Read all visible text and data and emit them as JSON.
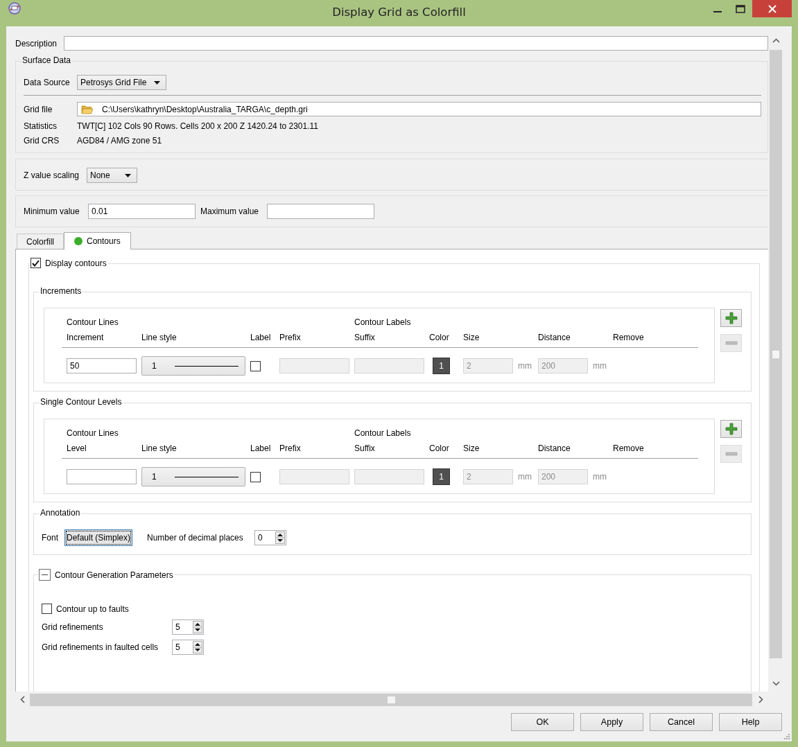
{
  "window": {
    "title": "Display Grid as Colorfill"
  },
  "description": {
    "label": "Description"
  },
  "surface_data": {
    "title": "Surface Data",
    "data_source": {
      "label": "Data Source",
      "value": "Petrosys Grid File"
    },
    "grid_file": {
      "label": "Grid file",
      "value": "C:\\Users\\kathryn\\Desktop\\Australia_TARGA\\c_depth.gri"
    },
    "statistics": {
      "label": "Statistics",
      "value": "TWT[C] 102 Cols 90 Rows. Cells 200 x 200 Z 1420.24 to 2301.11"
    },
    "grid_crs": {
      "label": "Grid CRS",
      "value": "AGD84 / AMG zone 51"
    }
  },
  "z_value_scaling": {
    "label": "Z value scaling",
    "value": "None"
  },
  "minimum_value": {
    "label": "Minimum value",
    "value": "0.01"
  },
  "maximum_value": {
    "label": "Maximum value"
  },
  "tabs": [
    {
      "label": "Colorfill",
      "selected": false
    },
    {
      "label": "Contours",
      "selected": true,
      "color": "#3dae2b"
    }
  ],
  "display_contours": {
    "label": "Display contours",
    "checked": true
  },
  "increments": {
    "title": "Increments",
    "lines_header": "Contour Lines",
    "labels_header": "Contour Labels",
    "columns": [
      "Increment",
      "Line style",
      "Label",
      "Prefix",
      "Suffix",
      "Color",
      "Size",
      "Distance",
      "Remove"
    ],
    "rows": [
      {
        "value": "50",
        "line_style": "1",
        "label_checked": false,
        "color_label": "1",
        "color": "#505050",
        "size": "2",
        "size_unit": "mm",
        "distance": "200",
        "distance_unit": "mm"
      }
    ]
  },
  "single_contour_levels": {
    "title": "Single Contour Levels",
    "lines_header": "Contour Lines",
    "labels_header": "Contour Labels",
    "columns": [
      "Level",
      "Line style",
      "Label",
      "Prefix",
      "Suffix",
      "Color",
      "Size",
      "Distance",
      "Remove"
    ],
    "rows": [
      {
        "line_style": "1",
        "label_checked": false,
        "color_label": "1",
        "color": "#505050",
        "size": "2",
        "size_unit": "mm",
        "distance": "200",
        "distance_unit": "mm"
      }
    ]
  },
  "annotation": {
    "title": "Annotation",
    "font_label": "Font",
    "font_value": "Default (Simplex)",
    "decimals_label": "Number of decimal places",
    "decimals": "0"
  },
  "contour_generation": {
    "title": "Contour Generation Parameters",
    "expanded": true,
    "contour_up_to_faults": {
      "label": "Contour up to faults",
      "checked": false
    },
    "grid_refinements": {
      "label": "Grid refinements",
      "value": "5"
    },
    "faulted_refinements": {
      "label": "Grid refinements in faulted cells",
      "value": "5"
    }
  },
  "buttons": [
    "OK",
    "Apply",
    "Cancel",
    "Help"
  ]
}
